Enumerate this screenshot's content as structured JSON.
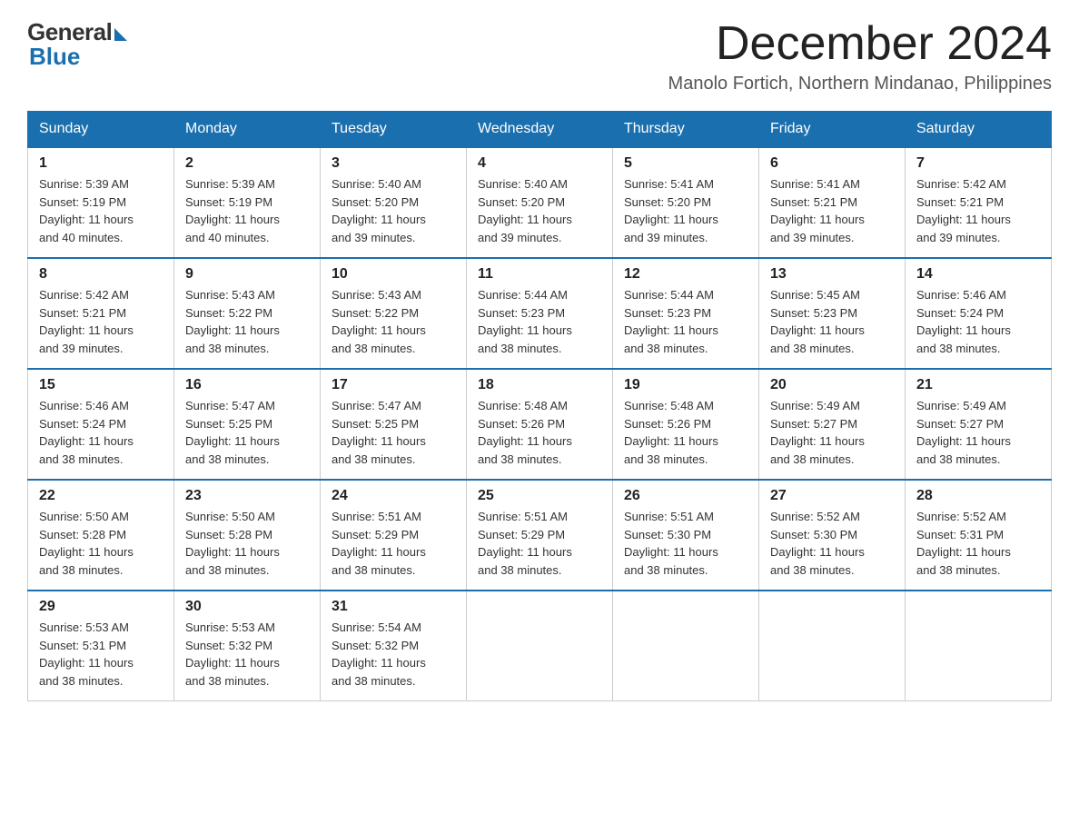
{
  "logo": {
    "general": "General",
    "blue": "Blue"
  },
  "title": "December 2024",
  "location": "Manolo Fortich, Northern Mindanao, Philippines",
  "days_of_week": [
    "Sunday",
    "Monday",
    "Tuesday",
    "Wednesday",
    "Thursday",
    "Friday",
    "Saturday"
  ],
  "weeks": [
    [
      {
        "day": "1",
        "sunrise": "5:39 AM",
        "sunset": "5:19 PM",
        "daylight": "11 hours and 40 minutes."
      },
      {
        "day": "2",
        "sunrise": "5:39 AM",
        "sunset": "5:19 PM",
        "daylight": "11 hours and 40 minutes."
      },
      {
        "day": "3",
        "sunrise": "5:40 AM",
        "sunset": "5:20 PM",
        "daylight": "11 hours and 39 minutes."
      },
      {
        "day": "4",
        "sunrise": "5:40 AM",
        "sunset": "5:20 PM",
        "daylight": "11 hours and 39 minutes."
      },
      {
        "day": "5",
        "sunrise": "5:41 AM",
        "sunset": "5:20 PM",
        "daylight": "11 hours and 39 minutes."
      },
      {
        "day": "6",
        "sunrise": "5:41 AM",
        "sunset": "5:21 PM",
        "daylight": "11 hours and 39 minutes."
      },
      {
        "day": "7",
        "sunrise": "5:42 AM",
        "sunset": "5:21 PM",
        "daylight": "11 hours and 39 minutes."
      }
    ],
    [
      {
        "day": "8",
        "sunrise": "5:42 AM",
        "sunset": "5:21 PM",
        "daylight": "11 hours and 39 minutes."
      },
      {
        "day": "9",
        "sunrise": "5:43 AM",
        "sunset": "5:22 PM",
        "daylight": "11 hours and 38 minutes."
      },
      {
        "day": "10",
        "sunrise": "5:43 AM",
        "sunset": "5:22 PM",
        "daylight": "11 hours and 38 minutes."
      },
      {
        "day": "11",
        "sunrise": "5:44 AM",
        "sunset": "5:23 PM",
        "daylight": "11 hours and 38 minutes."
      },
      {
        "day": "12",
        "sunrise": "5:44 AM",
        "sunset": "5:23 PM",
        "daylight": "11 hours and 38 minutes."
      },
      {
        "day": "13",
        "sunrise": "5:45 AM",
        "sunset": "5:23 PM",
        "daylight": "11 hours and 38 minutes."
      },
      {
        "day": "14",
        "sunrise": "5:46 AM",
        "sunset": "5:24 PM",
        "daylight": "11 hours and 38 minutes."
      }
    ],
    [
      {
        "day": "15",
        "sunrise": "5:46 AM",
        "sunset": "5:24 PM",
        "daylight": "11 hours and 38 minutes."
      },
      {
        "day": "16",
        "sunrise": "5:47 AM",
        "sunset": "5:25 PM",
        "daylight": "11 hours and 38 minutes."
      },
      {
        "day": "17",
        "sunrise": "5:47 AM",
        "sunset": "5:25 PM",
        "daylight": "11 hours and 38 minutes."
      },
      {
        "day": "18",
        "sunrise": "5:48 AM",
        "sunset": "5:26 PM",
        "daylight": "11 hours and 38 minutes."
      },
      {
        "day": "19",
        "sunrise": "5:48 AM",
        "sunset": "5:26 PM",
        "daylight": "11 hours and 38 minutes."
      },
      {
        "day": "20",
        "sunrise": "5:49 AM",
        "sunset": "5:27 PM",
        "daylight": "11 hours and 38 minutes."
      },
      {
        "day": "21",
        "sunrise": "5:49 AM",
        "sunset": "5:27 PM",
        "daylight": "11 hours and 38 minutes."
      }
    ],
    [
      {
        "day": "22",
        "sunrise": "5:50 AM",
        "sunset": "5:28 PM",
        "daylight": "11 hours and 38 minutes."
      },
      {
        "day": "23",
        "sunrise": "5:50 AM",
        "sunset": "5:28 PM",
        "daylight": "11 hours and 38 minutes."
      },
      {
        "day": "24",
        "sunrise": "5:51 AM",
        "sunset": "5:29 PM",
        "daylight": "11 hours and 38 minutes."
      },
      {
        "day": "25",
        "sunrise": "5:51 AM",
        "sunset": "5:29 PM",
        "daylight": "11 hours and 38 minutes."
      },
      {
        "day": "26",
        "sunrise": "5:51 AM",
        "sunset": "5:30 PM",
        "daylight": "11 hours and 38 minutes."
      },
      {
        "day": "27",
        "sunrise": "5:52 AM",
        "sunset": "5:30 PM",
        "daylight": "11 hours and 38 minutes."
      },
      {
        "day": "28",
        "sunrise": "5:52 AM",
        "sunset": "5:31 PM",
        "daylight": "11 hours and 38 minutes."
      }
    ],
    [
      {
        "day": "29",
        "sunrise": "5:53 AM",
        "sunset": "5:31 PM",
        "daylight": "11 hours and 38 minutes."
      },
      {
        "day": "30",
        "sunrise": "5:53 AM",
        "sunset": "5:32 PM",
        "daylight": "11 hours and 38 minutes."
      },
      {
        "day": "31",
        "sunrise": "5:54 AM",
        "sunset": "5:32 PM",
        "daylight": "11 hours and 38 minutes."
      },
      null,
      null,
      null,
      null
    ]
  ],
  "labels": {
    "sunrise": "Sunrise:",
    "sunset": "Sunset:",
    "daylight": "Daylight:"
  }
}
